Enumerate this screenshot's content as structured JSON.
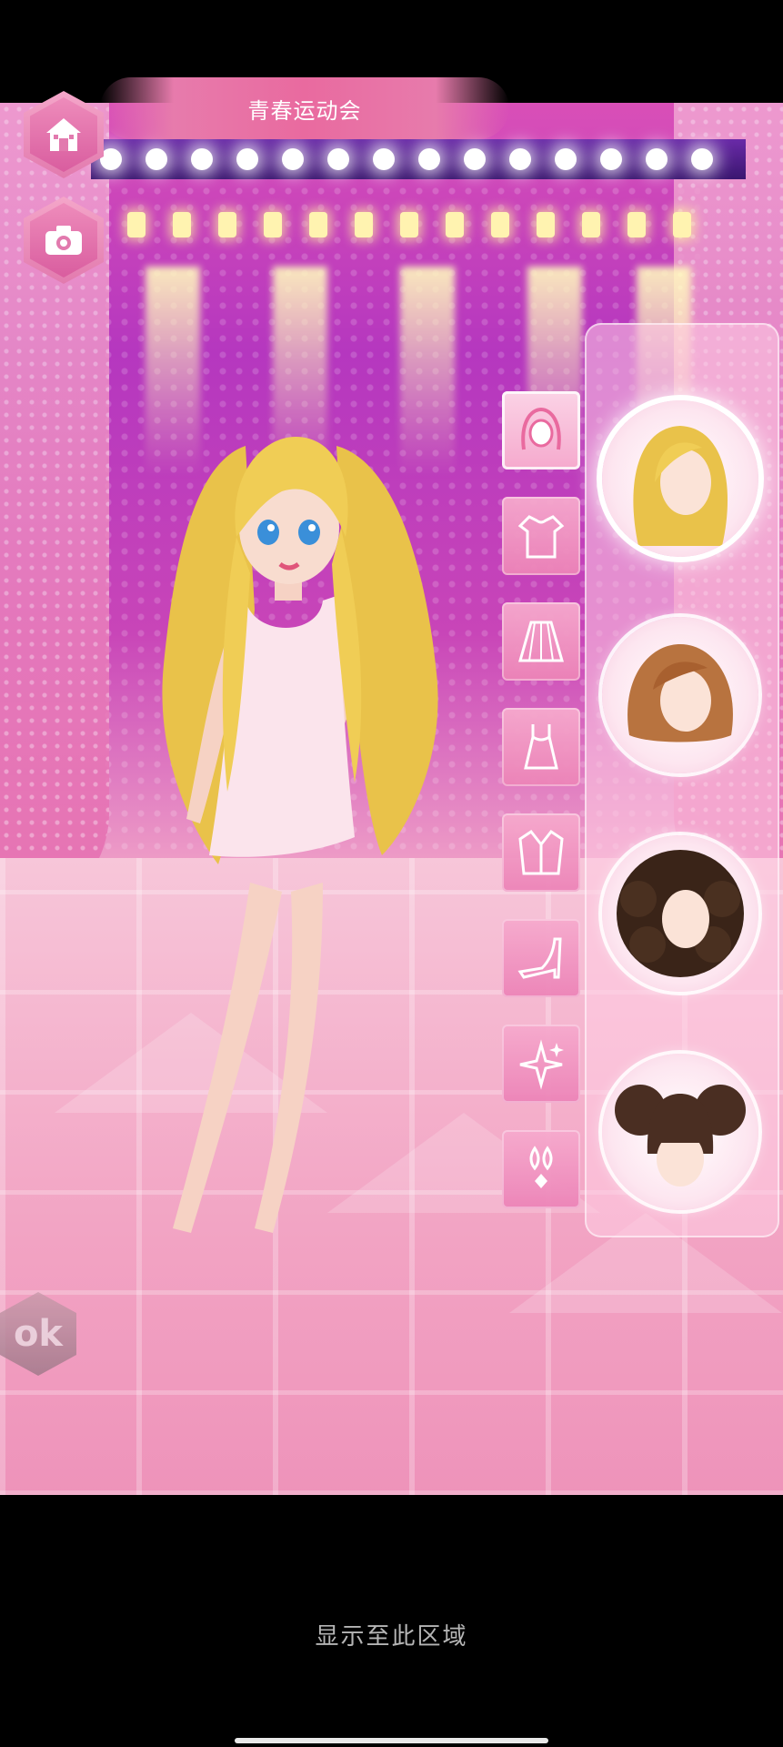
{
  "header": {
    "title": "青春运动会"
  },
  "sidebar_left": {
    "home_icon": "house-icon",
    "camera_icon": "camera-icon"
  },
  "categories": [
    {
      "name": "hair",
      "icon": "hair-icon",
      "active": true
    },
    {
      "name": "top",
      "icon": "shirt-icon",
      "active": false
    },
    {
      "name": "skirt",
      "icon": "skirt-icon",
      "active": false
    },
    {
      "name": "dress",
      "icon": "dress-icon",
      "active": false
    },
    {
      "name": "coat",
      "icon": "coat-icon",
      "active": false
    },
    {
      "name": "shoes",
      "icon": "high-heel-icon",
      "active": false
    },
    {
      "name": "accessory",
      "icon": "sparkle-icon",
      "active": false
    },
    {
      "name": "earrings",
      "icon": "earring-icon",
      "active": false
    }
  ],
  "hair_options": [
    {
      "style": "long-blonde",
      "color": "#e9c24a",
      "selected": true
    },
    {
      "style": "bob-auburn",
      "color": "#b8733f",
      "selected": false
    },
    {
      "style": "curly-dark",
      "color": "#3a2418",
      "selected": false
    },
    {
      "style": "double-buns-brown",
      "color": "#4a2e22",
      "selected": false
    }
  ],
  "ok_button": {
    "label": "ok"
  },
  "footer": {
    "note": "显示至此区域"
  },
  "colors": {
    "accent": "#e96a9f",
    "panel": "#ffcde4",
    "hair_blonde": "#e9c24a"
  }
}
